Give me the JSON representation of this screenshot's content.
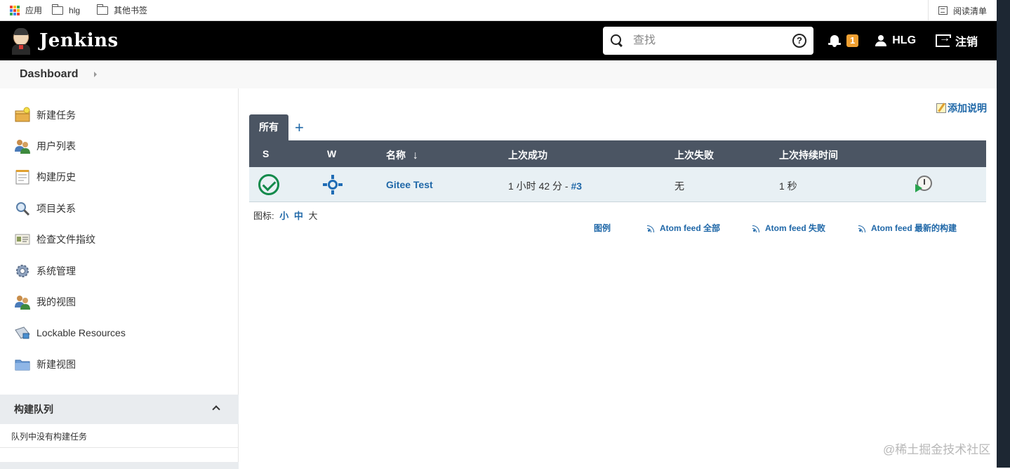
{
  "bookmarks": {
    "items": [
      {
        "label": "应用",
        "icon": "apps-grid-icon"
      },
      {
        "label": "hlg",
        "icon": "folder-icon"
      },
      {
        "label": "其他书签",
        "icon": "folder-icon"
      }
    ],
    "reading_list": "阅读清单",
    "apps_colors": [
      "#ea4335",
      "#fbbc05",
      "#34a853",
      "#4285f4",
      "#ea4335",
      "#fbbc05",
      "#34a853",
      "#4285f4",
      "#ea4335"
    ]
  },
  "header": {
    "brand": "Jenkins",
    "search_placeholder": "查找",
    "help": "?",
    "notification_count": "1",
    "user": "HLG",
    "logout": "注销",
    "colors": {
      "bar": "#000000",
      "badge": "#f0a032"
    }
  },
  "breadcrumb": {
    "items": [
      "Dashboard"
    ]
  },
  "sidebar": {
    "items": [
      {
        "label": "新建任务",
        "icon": "new-item-icon"
      },
      {
        "label": "用户列表",
        "icon": "people-icon"
      },
      {
        "label": "构建历史",
        "icon": "notepad-icon"
      },
      {
        "label": "项目关系",
        "icon": "magnifier-icon"
      },
      {
        "label": "检查文件指纹",
        "icon": "fingerprint-icon"
      },
      {
        "label": "系统管理",
        "icon": "gear-icon"
      },
      {
        "label": "我的视图",
        "icon": "people-icon"
      },
      {
        "label": "Lockable Resources",
        "icon": "lock-resource-icon"
      },
      {
        "label": "新建视图",
        "icon": "folder-icon"
      }
    ],
    "build_queue": {
      "title": "构建队列",
      "empty": "队列中没有构建任务"
    }
  },
  "main": {
    "add_description": "添加说明",
    "tabs": [
      {
        "label": "所有"
      }
    ],
    "add_tab": "+",
    "table": {
      "headers": {
        "s": "S",
        "w": "W",
        "name": "名称",
        "sort": "↓",
        "last_success": "上次成功",
        "last_failure": "上次失败",
        "last_duration": "上次持续时间"
      },
      "rows": [
        {
          "status": "success-icon",
          "weather": "sunny-icon",
          "name": "Gitee Test",
          "last_success": "1 小时 42 分 - ",
          "last_success_build": "#3",
          "last_failure": "无",
          "last_duration": "1 秒",
          "action": "schedule-build-icon"
        }
      ],
      "colors": {
        "header": "#4b5563",
        "row": "#e8f0f4",
        "success": "#138a4b",
        "link": "#2068a8"
      }
    },
    "icon_size": {
      "label": "图标:",
      "small": "小",
      "medium": "中",
      "large": "大"
    },
    "feeds": {
      "legend": "图例",
      "all": "Atom feed 全部",
      "failed": "Atom feed 失败",
      "latest": "Atom feed 最新的构建"
    }
  },
  "watermark": "@稀土掘金技术社区"
}
